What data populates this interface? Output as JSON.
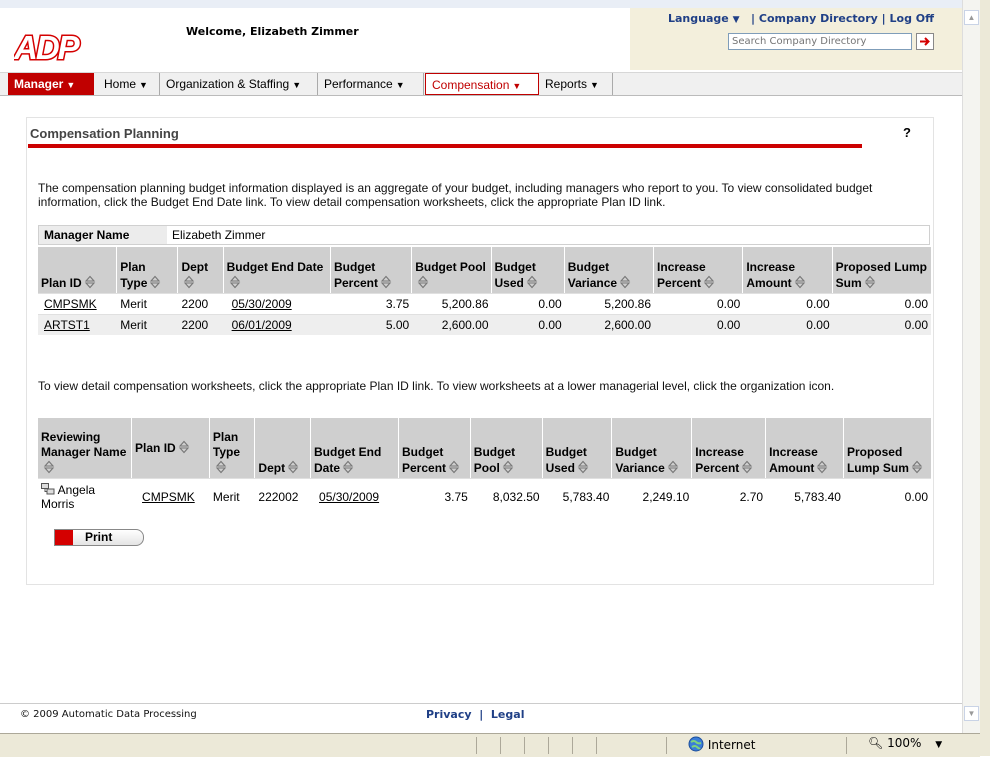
{
  "header": {
    "logo_text": "ADP",
    "welcome": "Welcome, Elizabeth Zimmer",
    "language_link": "Language",
    "company_directory_link": "Company Directory",
    "logoff_link": "Log Off",
    "separator": "|",
    "search_placeholder": "Search Company Directory"
  },
  "nav": {
    "items": [
      "Manager",
      "Home",
      "Organization & Staffing",
      "Performance",
      "Compensation",
      "Reports"
    ],
    "active": "Compensation"
  },
  "page": {
    "title": "Compensation Planning",
    "help": "?",
    "intro": "The compensation planning budget information displayed is an aggregate of your budget, including managers who report to you. To view consolidated budget information, click the Budget End Date link. To view detail compensation worksheets, click the appropriate Plan ID link.",
    "manager_name_label": "Manager Name",
    "manager_name_value": "Elizabeth Zimmer",
    "intro2": "To view detail compensation worksheets, click the appropriate Plan ID link. To view worksheets at a lower managerial level, click the organization icon."
  },
  "budget_table": {
    "headers": [
      "Plan ID",
      "Plan Type",
      "Dept",
      "Budget End Date",
      "Budget Percent",
      "Budget Pool",
      "Budget Used",
      "Budget Variance",
      "Increase Percent",
      "Increase Amount",
      "Proposed Lump Sum"
    ],
    "rows": [
      [
        "CMPSMK",
        "Merit",
        "2200",
        "05/30/2009",
        "3.75",
        "5,200.86",
        "0.00",
        "5,200.86",
        "0.00",
        "0.00",
        "0.00"
      ],
      [
        "ARTST1",
        "Merit",
        "2200",
        "06/01/2009",
        "5.00",
        "2,600.00",
        "0.00",
        "2,600.00",
        "0.00",
        "0.00",
        "0.00"
      ]
    ]
  },
  "worksheet_table": {
    "headers": [
      "Reviewing Manager Name",
      "Plan ID",
      "Plan Type",
      "Dept",
      "Budget End Date",
      "Budget Percent",
      "Budget Pool",
      "Budget Used",
      "Budget Variance",
      "Increase Percent",
      "Increase Amount",
      "Proposed Lump Sum"
    ],
    "rows": [
      [
        "Angela Morris",
        "CMPSMK",
        "Merit",
        "222002",
        "05/30/2009",
        "3.75",
        "8,032.50",
        "5,783.40",
        "2,249.10",
        "2.70",
        "5,783.40",
        "0.00"
      ]
    ]
  },
  "print_label": "Print",
  "footer": {
    "copyright": "© 2009 Automatic Data Processing",
    "privacy": "Privacy",
    "legal": "Legal",
    "separator": "|"
  },
  "statusbar": {
    "zone": "Internet",
    "zoom": "100%"
  },
  "colors": {
    "brand_red": "#c00000",
    "link_blue": "#1f3f86",
    "header_gray": "#cfcfcf"
  }
}
